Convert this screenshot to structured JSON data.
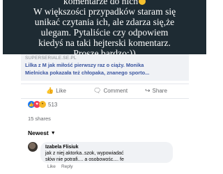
{
  "overlay": {
    "line1": "komentarze do nich",
    "line2": "W większości przypadków staram się",
    "line3": "unikać czytania ich, ale zdarza się,że",
    "line4": "ulegam. Pytaliście czy odpowiem",
    "line5": "kiedyś na taki hejterski komentarz.",
    "line6": "Proszę bardzo:))"
  },
  "preview": {
    "source": "SUPERSERIALE.SE.PL",
    "title_line1": "Lilka z M jak miłość pierwszy raz o ciąży. Monika",
    "title_line2": "Mielnicka pokazała też chłopaka, znanego sporto..."
  },
  "actions": {
    "like": "Like",
    "comment": "Comment",
    "share": "Share"
  },
  "reactions": {
    "count": "513"
  },
  "shares": "15 shares",
  "sort": {
    "label": "Newest"
  },
  "comment": {
    "author": "Izabela Flisiuk",
    "line1": "jak z niej aktorka..szok, wypowiadać",
    "line2": "słów nie potrafi.... a osobowośc.... fe",
    "like": "Like",
    "reply": "Reply"
  },
  "colors": {
    "overlay_bg": "#1e2b33",
    "link_blue": "#3a55a0",
    "like_blue": "#1877f2"
  }
}
